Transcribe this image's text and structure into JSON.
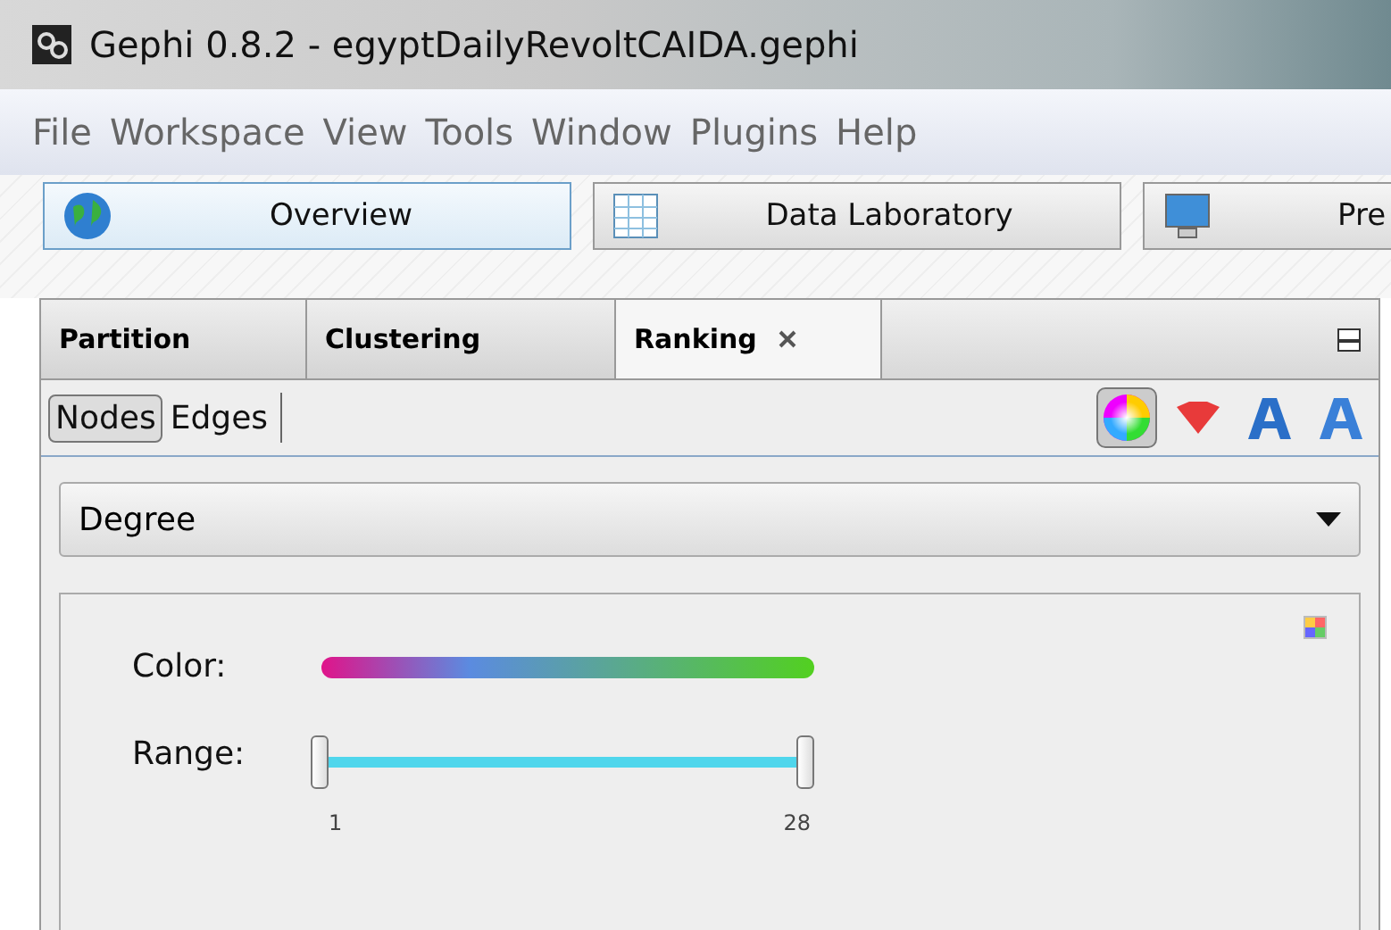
{
  "window": {
    "title": "Gephi 0.8.2 - egyptDailyRevoltCAIDA.gephi"
  },
  "menu": [
    "File",
    "Workspace",
    "View",
    "Tools",
    "Window",
    "Plugins",
    "Help"
  ],
  "workspaces": [
    {
      "label": "Overview",
      "kind": "globe",
      "selected": true
    },
    {
      "label": "Data Laboratory",
      "kind": "table",
      "selected": false
    },
    {
      "label": "Pre",
      "kind": "monitor",
      "selected": false
    }
  ],
  "tabs": [
    {
      "label": "Partition",
      "selected": false,
      "closable": false
    },
    {
      "label": "Clustering",
      "selected": false,
      "closable": false
    },
    {
      "label": "Ranking",
      "selected": true,
      "closable": true
    }
  ],
  "element_toggle": [
    {
      "label": "Nodes",
      "selected": true
    },
    {
      "label": "Edges",
      "selected": false
    }
  ],
  "transformers": [
    {
      "kind": "color",
      "selected": true
    },
    {
      "kind": "size",
      "selected": false
    },
    {
      "kind": "label-color",
      "selected": false
    },
    {
      "kind": "label-size",
      "selected": false
    }
  ],
  "ranking": {
    "value": "Degree"
  },
  "color": {
    "label": "Color:"
  },
  "range": {
    "label": "Range:",
    "level": 1,
    "min": "1",
    "max": "28"
  }
}
